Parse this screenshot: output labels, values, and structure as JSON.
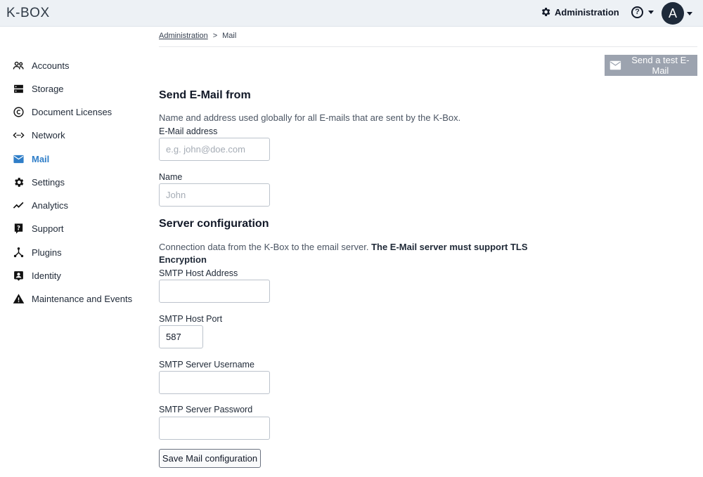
{
  "header": {
    "logo": "K-BOX",
    "admin_label": "Administration",
    "help_label": "?",
    "avatar_initial": "A"
  },
  "sidebar": {
    "items": [
      {
        "label": "Accounts",
        "icon": "users-icon"
      },
      {
        "label": "Storage",
        "icon": "storage-icon"
      },
      {
        "label": "Document Licenses",
        "icon": "copyright-icon"
      },
      {
        "label": "Network",
        "icon": "network-icon"
      },
      {
        "label": "Mail",
        "icon": "mail-icon",
        "active": true
      },
      {
        "label": "Settings",
        "icon": "gear-icon"
      },
      {
        "label": "Analytics",
        "icon": "analytics-icon"
      },
      {
        "label": "Support",
        "icon": "support-icon"
      },
      {
        "label": "Plugins",
        "icon": "plugins-icon"
      },
      {
        "label": "Identity",
        "icon": "identity-icon"
      },
      {
        "label": "Maintenance and Events",
        "icon": "warning-icon"
      }
    ]
  },
  "breadcrumb": {
    "parent": "Administration",
    "separator": ">",
    "current": "Mail"
  },
  "actions": {
    "send_test_label": "Send a test E-Mail"
  },
  "send_from": {
    "title": "Send E-Mail from",
    "description": "Name and address used globally for all E-mails that are sent by the K-Box.",
    "email_label": "E-Mail address",
    "email_placeholder": "e.g. john@doe.com",
    "email_value": "",
    "name_label": "Name",
    "name_placeholder": "John",
    "name_value": ""
  },
  "server": {
    "title": "Server configuration",
    "description": "Connection data from the K-Box to the email server.",
    "description_bold": "The E-Mail server must support TLS Encryption",
    "host_label": "SMTP Host Address",
    "host_value": "",
    "port_label": "SMTP Host Port",
    "port_value": "587",
    "username_label": "SMTP Server Username",
    "username_value": "",
    "password_label": "SMTP Server Password",
    "password_value": ""
  },
  "form": {
    "save_label": "Save Mail configuration"
  },
  "colors": {
    "accent": "#2f7ec8",
    "topbar": "#edf1f5",
    "disabled_button": "#9ca3af"
  }
}
